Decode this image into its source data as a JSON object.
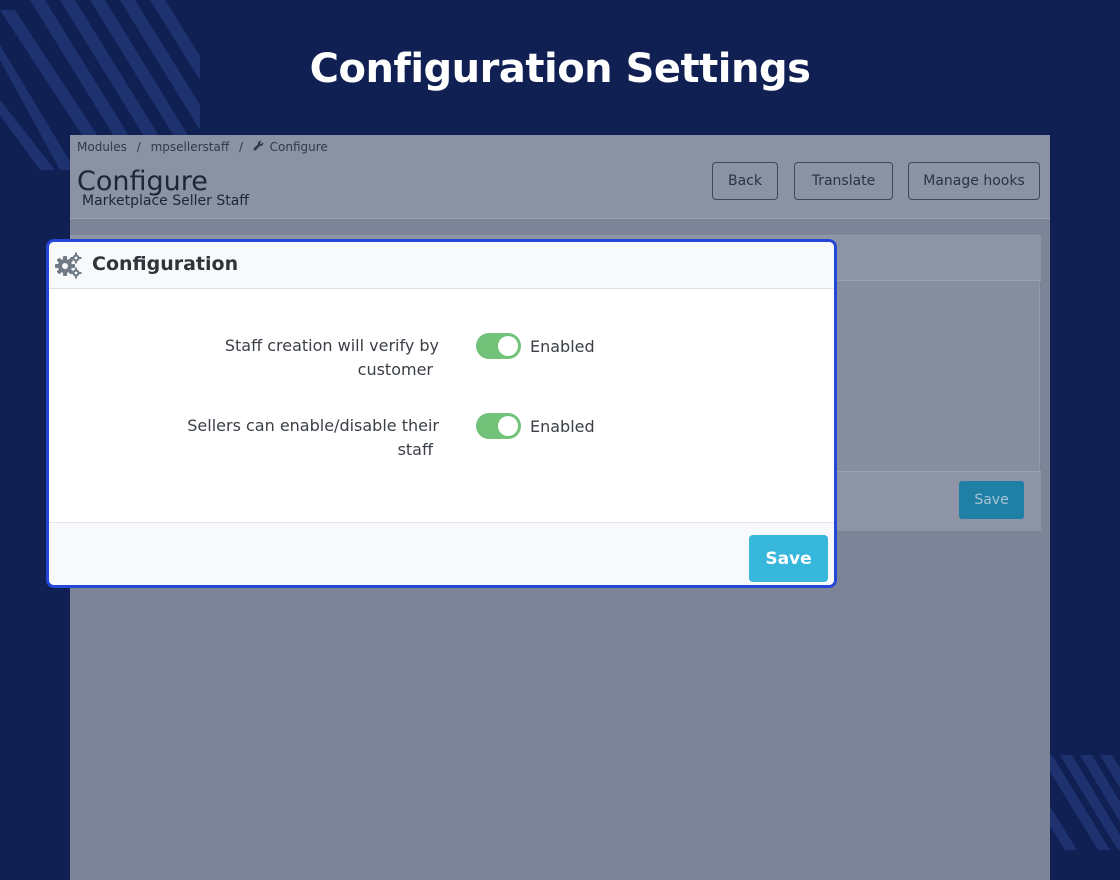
{
  "banner": {
    "title": "Configuration Settings"
  },
  "background_page": {
    "breadcrumb": [
      "Modules",
      "/",
      "mpsellerstaff",
      "/",
      "Configure"
    ],
    "breadcrumb_icon": "wrench-icon",
    "title": "Configure",
    "subtitle": "Marketplace Seller Staff",
    "buttons": {
      "back": "Back",
      "translate": "Translate",
      "manage_hooks": "Manage hooks"
    },
    "save_label": "Save"
  },
  "modal": {
    "icon": "gears-icon",
    "title": "Configuration",
    "rows": [
      {
        "label_line1": "Staff creation will verify by",
        "label_line2": "customer",
        "toggle_on": true,
        "status": "Enabled"
      },
      {
        "label_line1": "Sellers can enable/disable their",
        "label_line2": "staff",
        "toggle_on": true,
        "status": "Enabled"
      }
    ],
    "save_label": "Save"
  },
  "colors": {
    "banner_bg": "#112053",
    "accent_border": "#2547d8",
    "toggle_on": "#72c279",
    "save_button": "#36b7db"
  }
}
